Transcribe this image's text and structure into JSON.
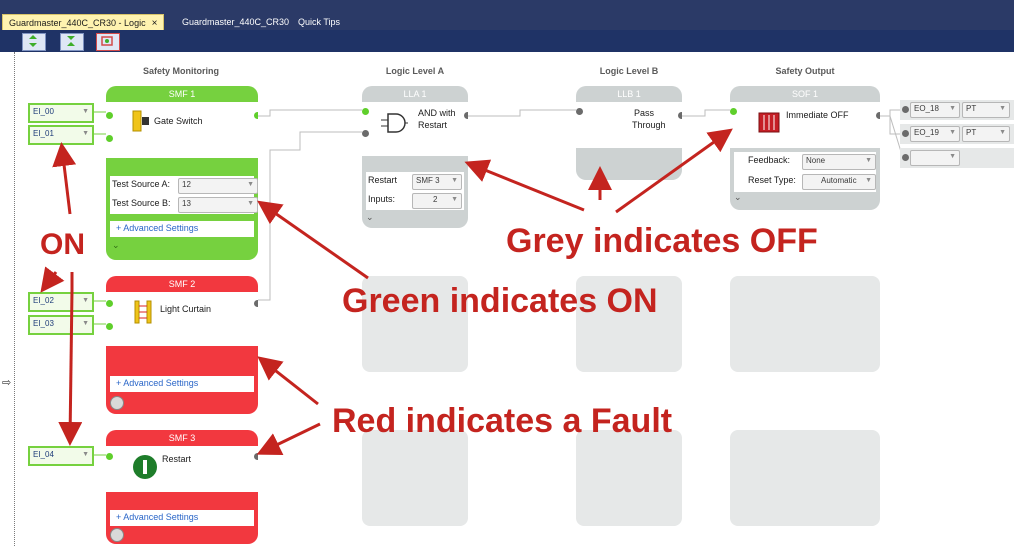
{
  "tabs": [
    {
      "label": "Guardmaster_440C_CR30 - Logic",
      "close": "×",
      "active": true
    },
    {
      "label": "Guardmaster_440C_CR30",
      "active": false
    },
    {
      "label": "Quick Tips",
      "active": false
    }
  ],
  "columns": {
    "safety_monitoring": "Safety Monitoring",
    "logic_level_a": "Logic Level A",
    "logic_level_b": "Logic Level B",
    "safety_output": "Safety Output"
  },
  "inputs": {
    "ei00": "EI_00",
    "ei01": "EI_01",
    "ei02": "EI_02",
    "ei03": "EI_03",
    "ei04": "EI_04"
  },
  "smf1": {
    "title": "SMF 1",
    "device": "Gate Switch",
    "test_source_a_label": "Test Source A:",
    "test_source_a": "12",
    "test_source_b_label": "Test Source B:",
    "test_source_b": "13",
    "advanced": "+ Advanced Settings"
  },
  "smf2": {
    "title": "SMF 2",
    "device": "Light Curtain",
    "advanced": "+ Advanced Settings"
  },
  "smf3": {
    "title": "SMF 3",
    "device": "Restart",
    "advanced": "+ Advanced Settings"
  },
  "lla1": {
    "title": "LLA 1",
    "function_line1": "AND with",
    "function_line2": "Restart",
    "restart_label": "Restart",
    "restart_value": "SMF 3",
    "inputs_label": "Inputs:",
    "inputs_value": "2"
  },
  "llb1": {
    "title": "LLB 1",
    "function_line1": "Pass",
    "function_line2": "Through"
  },
  "sof1": {
    "title": "SOF 1",
    "function": "Immediate OFF",
    "feedback_label": "Feedback:",
    "feedback_value": "None",
    "reset_type_label": "Reset Type:",
    "reset_type_value": "Automatic"
  },
  "outputs": {
    "eo18": "EO_18",
    "eo18_mode": "PT",
    "eo19": "EO_19",
    "eo19_mode": "PT"
  },
  "annotations": {
    "on": "ON",
    "grey": "Grey indicates OFF",
    "green": "Green indicates ON",
    "red": "Red indicates a Fault"
  },
  "colors": {
    "on_green": "#76d13f",
    "fault_red": "#f2383f",
    "off_grey": "#cdd2d2",
    "annotation_red": "#c4241f",
    "tab_bar": "#2b3a67"
  },
  "icons": [
    "gate-switch-icon",
    "light-curtain-icon",
    "restart-button-icon",
    "and-gate-icon",
    "safety-relay-icon",
    "expand-chevron-icon"
  ]
}
